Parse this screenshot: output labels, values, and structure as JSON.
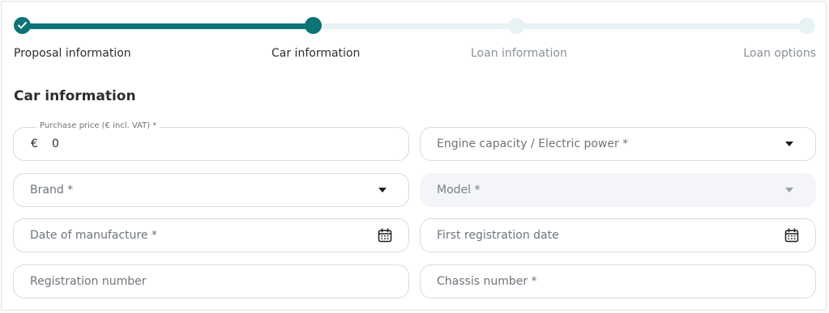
{
  "stepper": {
    "steps": [
      {
        "label": "Proposal information",
        "state": "done"
      },
      {
        "label": "Car information",
        "state": "active"
      },
      {
        "label": "Loan information",
        "state": "todo"
      },
      {
        "label": "Loan options",
        "state": "todo"
      }
    ],
    "accent": "#0d7377"
  },
  "section": {
    "title": "Car information"
  },
  "fields": {
    "purchase_price": {
      "label": "Purchase price (€ incl. VAT) *",
      "prefix": "€",
      "value": "0"
    },
    "engine": {
      "placeholder": "Engine capacity / Electric power *",
      "icon": "chevron-down-icon"
    },
    "brand": {
      "placeholder": "Brand *",
      "icon": "chevron-down-icon"
    },
    "model": {
      "placeholder": "Model *",
      "icon": "chevron-down-icon",
      "disabled": true
    },
    "manufacture_date": {
      "placeholder": "Date of manufacture *",
      "icon": "calendar-icon"
    },
    "first_registration": {
      "placeholder": "First registration date",
      "icon": "calendar-icon"
    },
    "registration_number": {
      "placeholder": "Registration number"
    },
    "chassis_number": {
      "placeholder": "Chassis number *"
    }
  }
}
